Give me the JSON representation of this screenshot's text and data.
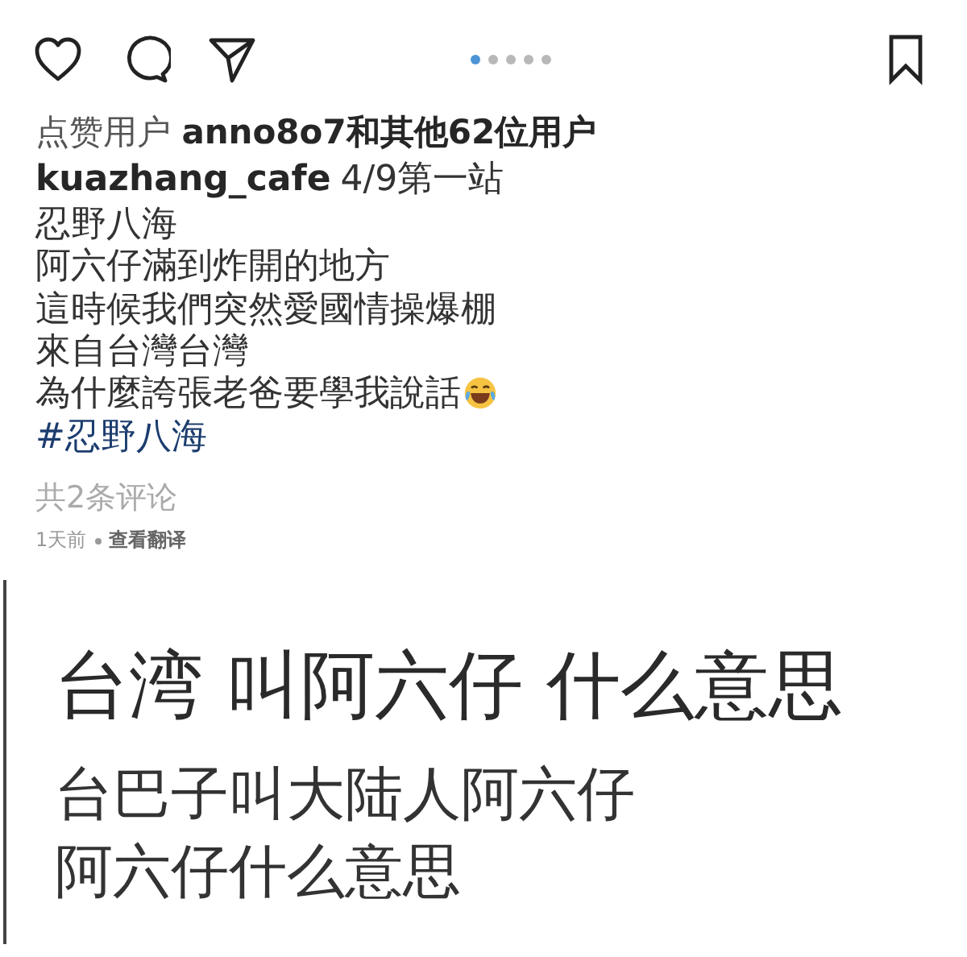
{
  "post": {
    "actions": [
      {
        "kind": "like"
      },
      {
        "kind": "comment"
      },
      {
        "kind": "share"
      }
    ],
    "carousel_dots": [
      {
        "selected": true
      },
      {
        "selected": false
      },
      {
        "selected": false
      },
      {
        "selected": false
      },
      {
        "selected": false
      }
    ],
    "likes": "点赞用户 **anno8o7和其他62位用户**",
    "caption": {
      "username": "kuazhang_cafe",
      "first_line": "4/9第一站",
      "lines": [
        {
          "text": "忍野八海",
          "kind": "text",
          "has_emoji": false
        },
        {
          "text": "阿六仔滿到炸開的地方",
          "kind": "text",
          "has_emoji": false
        },
        {
          "text": "這時候我們突然愛國情操爆棚",
          "kind": "text",
          "has_emoji": false
        },
        {
          "text": "來自台灣台灣",
          "kind": "text",
          "has_emoji": false
        },
        {
          "text": "為什麼誇張老爸要學我說話",
          "kind": "text",
          "has_emoji": true
        },
        {
          "text": "#忍野八海",
          "kind": "hashtag",
          "has_emoji": false
        }
      ]
    },
    "comments_count": "共2条评论",
    "time": "1天前",
    "translate": "查看翻译"
  },
  "answer": {
    "question": "台湾 叫阿六仔 什么意思",
    "lines": [
      "台巴子叫大陆人阿六仔",
      "阿六仔什么意思"
    ]
  }
}
